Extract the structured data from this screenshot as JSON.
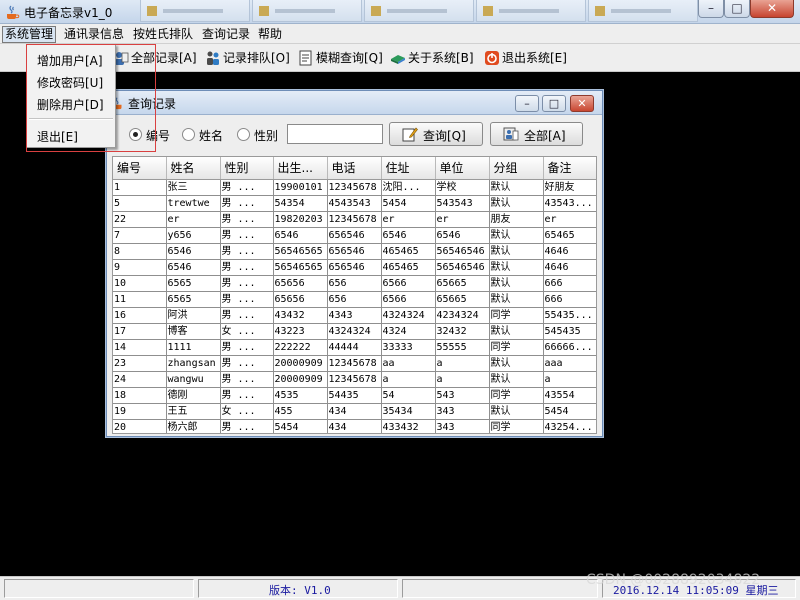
{
  "window": {
    "title": "电子备忘录v1_0",
    "controls": {
      "minimize": "–",
      "maximize": "□",
      "close": "✕"
    }
  },
  "menubar": [
    {
      "id": "system",
      "label": "系统管理"
    },
    {
      "id": "contacts",
      "label": "通讯录信息"
    },
    {
      "id": "sort",
      "label": "按姓氏排队"
    },
    {
      "id": "query",
      "label": "查询记录"
    },
    {
      "id": "help",
      "label": "帮助"
    }
  ],
  "toolbar": [
    {
      "label": "全部记录[A]",
      "icon": "records-icon"
    },
    {
      "label": "记录排队[O]",
      "icon": "sort-icon"
    },
    {
      "label": "模糊查询[Q]",
      "icon": "document-search-icon"
    },
    {
      "label": "关于系统[B]",
      "icon": "book-icon"
    },
    {
      "label": "退出系统[E]",
      "icon": "power-icon"
    }
  ],
  "dropdown": {
    "items": [
      "增加用户[A]",
      "修改密码[U]",
      "删除用户[D]"
    ],
    "exit": "退出[E]"
  },
  "query_window": {
    "title": "查询记录",
    "radios": [
      {
        "label": "编号",
        "checked": true
      },
      {
        "label": "姓名",
        "checked": false
      },
      {
        "label": "性别",
        "checked": false
      }
    ],
    "search_value": "",
    "buttons": {
      "query": "查询[Q]",
      "all": "全部[A]"
    }
  },
  "table": {
    "columns": [
      "编号",
      "姓名",
      "性别",
      "出生...",
      "电话",
      "住址",
      "单位",
      "分组",
      "备注"
    ],
    "rows": [
      [
        "1",
        "张三",
        "男    ...",
        "19900101",
        "12345678",
        "沈阳...",
        "学校",
        "默认",
        "好朋友"
      ],
      [
        "5",
        "trewtwe",
        "男    ...",
        "54354",
        "4543543",
        "5454",
        "543543",
        "默认",
        "43543..."
      ],
      [
        "22",
        "er",
        "男    ...",
        "19820203",
        "12345678",
        "er",
        "er",
        "朋友",
        "er"
      ],
      [
        "7",
        "y656",
        "男    ...",
        "6546",
        "656546",
        "6546",
        "6546",
        "默认",
        "65465"
      ],
      [
        "8",
        "6546",
        "男    ...",
        "56546565",
        "656546",
        "465465",
        "56546546",
        "默认",
        "4646"
      ],
      [
        "9",
        "6546",
        "男    ...",
        "56546565",
        "656546",
        "465465",
        "56546546",
        "默认",
        "4646"
      ],
      [
        "10",
        "6565",
        "男    ...",
        "65656",
        "656",
        "6566",
        "65665",
        "默认",
        "666"
      ],
      [
        "11",
        "6565",
        "男    ...",
        "65656",
        "656",
        "6566",
        "65665",
        "默认",
        "666"
      ],
      [
        "16",
        "阿洪",
        "男    ...",
        "43432",
        "4343",
        "4324324",
        "4234324",
        "同学",
        "55435..."
      ],
      [
        "17",
        "博客",
        "女    ...",
        "43223",
        "4324324",
        "4324",
        "32432",
        "默认",
        "545435"
      ],
      [
        "14",
        "1111",
        "男    ...",
        "222222",
        "44444",
        "33333",
        "55555",
        "同学",
        "66666..."
      ],
      [
        "23",
        "zhangsan",
        "男    ...",
        "20000909",
        "12345678",
        "aa",
        "a",
        "默认",
        "aaa"
      ],
      [
        "24",
        "wangwu",
        "男    ...",
        "20000909",
        "12345678",
        "a",
        "a",
        "默认",
        "a"
      ],
      [
        "18",
        "德刚",
        "男    ...",
        "4535",
        "54435",
        "54",
        "543",
        "同学",
        "43554"
      ],
      [
        "19",
        "王五",
        "女    ...",
        "455",
        "434",
        "35434",
        "343",
        "默认",
        "5454"
      ],
      [
        "20",
        "杨六郎",
        "男    ...",
        "5454",
        "434",
        "433432",
        "343",
        "同学",
        "43254..."
      ]
    ]
  },
  "statusbar": {
    "version": "版本: V1.0",
    "datetime": "2016.12.14 11:05:09  星期三"
  },
  "watermark": "CSDN @0028892034822",
  "colors": {
    "highlight_box": "#d94040",
    "status_text": "#1a1aa0"
  }
}
